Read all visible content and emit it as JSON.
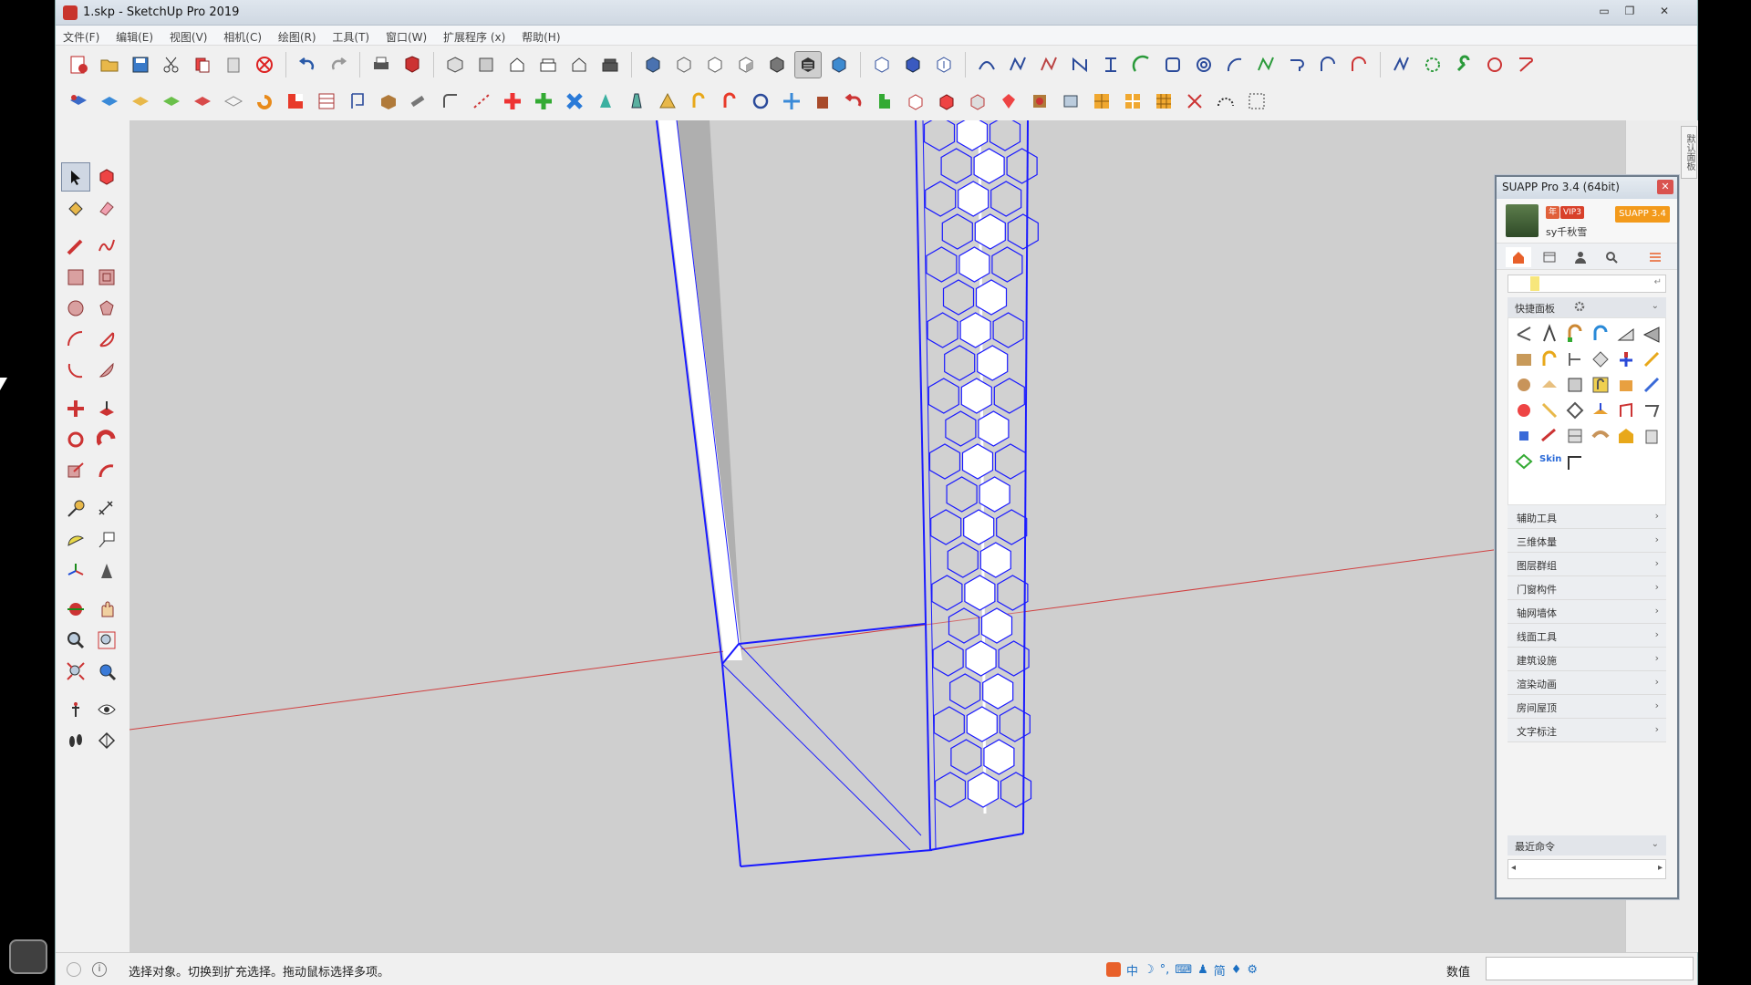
{
  "window": {
    "title": "1.skp - SketchUp Pro 2019",
    "controls": [
      "▭",
      "❐",
      "✕"
    ]
  },
  "menubar": {
    "items": [
      "文件(F)",
      "编辑(E)",
      "视图(V)",
      "相机(C)",
      "绘图(R)",
      "工具(T)",
      "窗口(W)",
      "扩展程序 (x)",
      "帮助(H)"
    ]
  },
  "viewport": {
    "background": "#cfcfcf",
    "selection_color": "#1a1aff",
    "axis_red": "#d04040"
  },
  "right_strip": {
    "tab_label": "默认面板"
  },
  "suapp": {
    "title": "SUAPP Pro 3.4 (64bit)",
    "close": "✕",
    "badges": [
      "年",
      "VIP3"
    ],
    "username": "sy千秋雪",
    "version_button": "SUAPP 3.4",
    "search_placeholder": "",
    "quick_panel_label": "快捷面板",
    "skin_label": "Skin",
    "categories": [
      "辅助工具",
      "三维体量",
      "图层群组",
      "门窗构件",
      "轴网墙体",
      "线面工具",
      "建筑设施",
      "渲染动画",
      "房间屋顶",
      "文字标注"
    ],
    "recent_label": "最近命令",
    "chevron": "›",
    "scroll_left": "◂",
    "scroll_right": "▸"
  },
  "statusbar": {
    "info_icon": "i",
    "message": "选择对象。切换到扩充选择。拖动鼠标选择多项。",
    "ime": [
      "中",
      "简"
    ],
    "measurements_label": "数值",
    "measurements_value": ""
  }
}
